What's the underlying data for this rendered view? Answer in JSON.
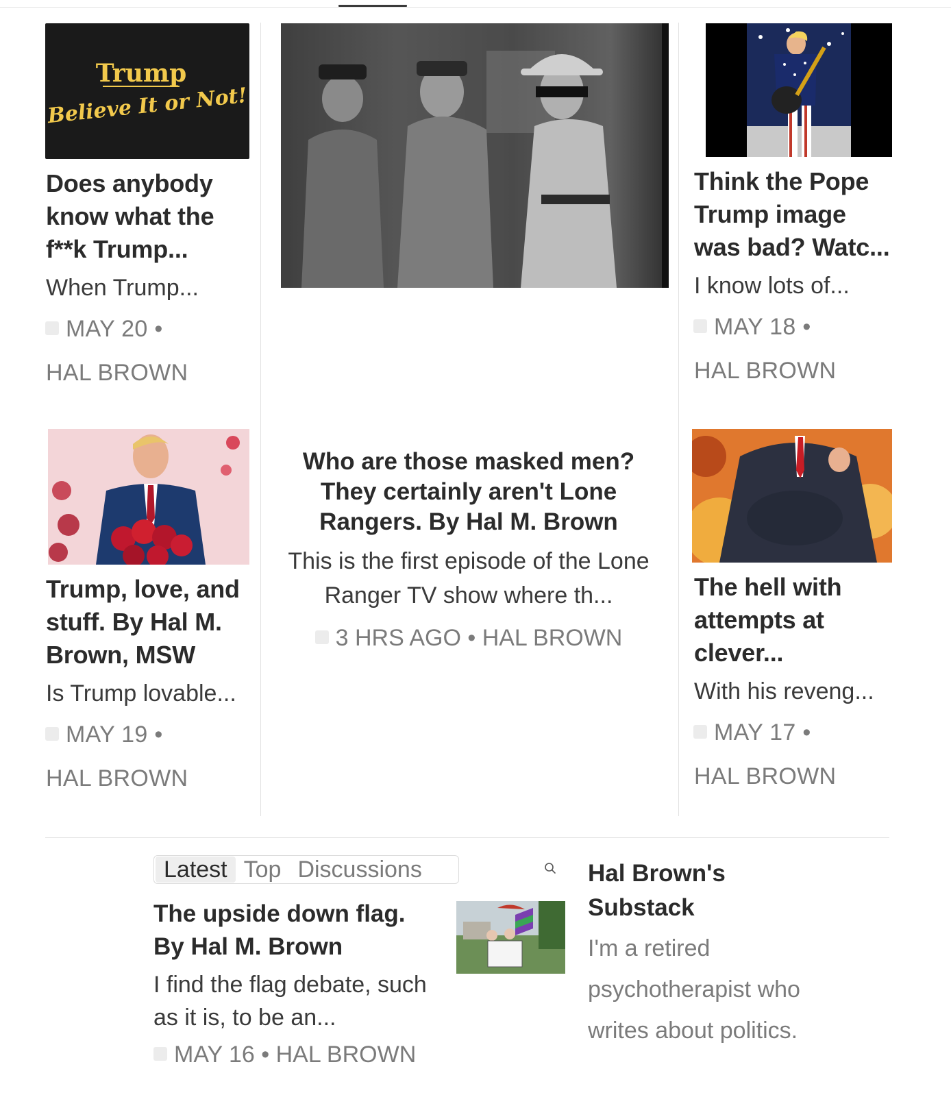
{
  "cards": {
    "c1": {
      "title": "Does anybody know what the f**k Trump...",
      "subtitle": "When Trump...",
      "date": "MAY 20 •",
      "author": "HAL BROWN",
      "thumb_line1": "Trump",
      "thumb_line2": "Believe It or Not!"
    },
    "c2": {
      "title": "Trump, love, and stuff. By Hal M. Brown, MSW",
      "subtitle": "Is Trump lovable...",
      "date": "MAY 19 •",
      "author": "HAL BROWN"
    },
    "c3": {
      "title": "Think the Pope Trump image was bad? Watc...",
      "subtitle": "I know lots of...",
      "date": "MAY 18 •",
      "author": "HAL BROWN"
    },
    "c4": {
      "title": "The hell with attempts at clever...",
      "subtitle": "With his reveng...",
      "date": "MAY 17 •",
      "author": "HAL BROWN"
    },
    "featured": {
      "title": "Who are those masked men? They certainly aren't Lone Rangers. By Hal M. Brown",
      "subtitle": "This is the first episode of the Lone Ranger TV show where th...",
      "meta": "3 HRS AGO • HAL BROWN"
    }
  },
  "tabs": {
    "latest": "Latest",
    "top": "Top",
    "discussions": "Discussions"
  },
  "latest_post": {
    "title": "The upside down flag. By Hal M. Brown",
    "subtitle": "I find the flag debate, such as it is, to be an...",
    "meta": "MAY 16 • HAL BROWN"
  },
  "publication": {
    "title": "Hal Brown's Substack",
    "description": "I'm a retired psychotherapist who writes about politics."
  },
  "icons": [
    "search-icon",
    "avatar-icon"
  ]
}
